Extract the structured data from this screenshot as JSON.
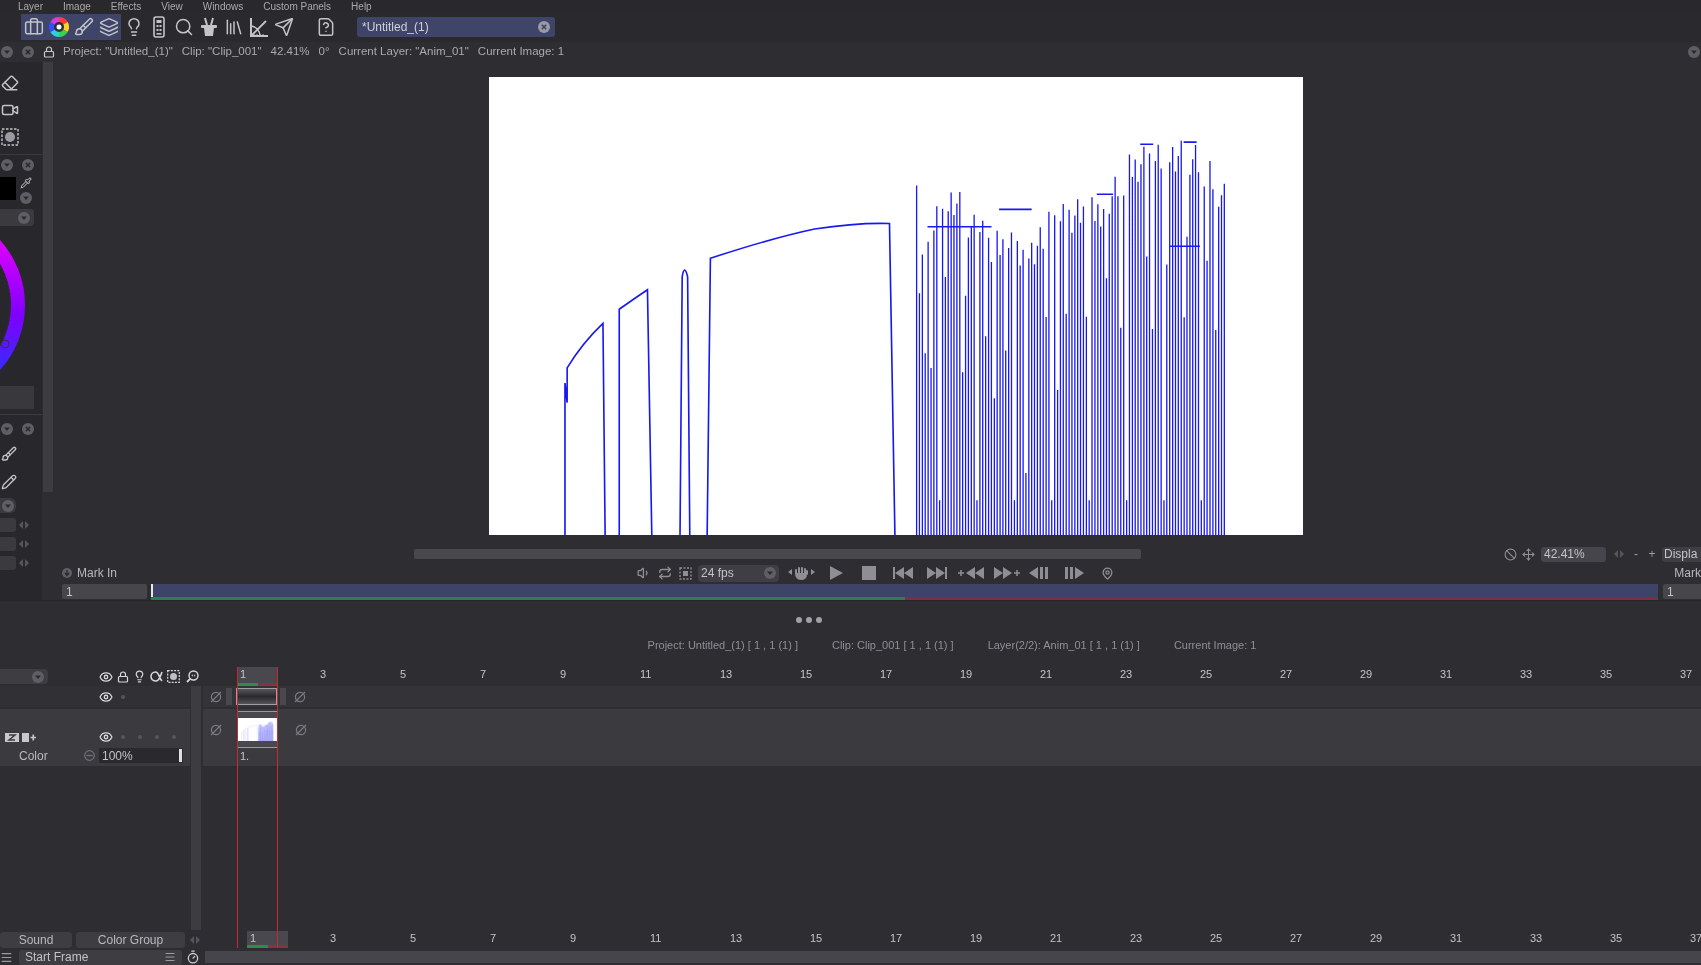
{
  "menu": [
    "Layer",
    "Image",
    "Effects",
    "View",
    "Windows",
    "Custom Panels",
    "Help"
  ],
  "toolbar": {
    "buttons": [
      {
        "selected": true
      },
      {
        "selected": true
      },
      {
        "selected": true
      },
      {
        "selected": true
      },
      {
        "selected": false
      },
      {
        "selected": false
      },
      {
        "selected": false
      },
      {
        "selected": false
      },
      {
        "selected": false
      },
      {
        "selected": false
      },
      {
        "selected": false
      },
      {
        "selected": false
      }
    ]
  },
  "document_tab": {
    "label": "*Untitled_(1)",
    "selected": true
  },
  "info_bar": [
    "Project: \"Untitled_(1)\"",
    "Clip: \"Clip_001\"",
    "42.41%",
    "0°",
    "Current Layer: \"Anim_01\"",
    "Current Image: 1"
  ],
  "viewer": {
    "zoom_field": "42.41%",
    "zoom_out": "-",
    "zoom_in": "+",
    "display_button": "Displa"
  },
  "playback": {
    "mark_in": "Mark In",
    "fps": "24 fps",
    "mark_out": "Mark",
    "start_field": "1",
    "end_field": "1",
    "range": {
      "level": 0.5
    }
  },
  "status": [
    "Project: Untitled_(1) [ 1 , 1 (1) ]",
    "Clip: Clip_001 [ 1 , 1 (1) ]",
    "Layer(2/2): Anim_01 [ 1 , 1 (1) ]",
    "Current Image: 1"
  ],
  "timeline": {
    "frames": [
      {
        "label": "1",
        "selected": true
      },
      {
        "label": "3",
        "selected": false
      },
      {
        "label": "5",
        "selected": false
      },
      {
        "label": "7",
        "selected": false
      },
      {
        "label": "9",
        "selected": false
      },
      {
        "label": "11",
        "selected": false
      },
      {
        "label": "13",
        "selected": false
      },
      {
        "label": "15",
        "selected": false
      },
      {
        "label": "17",
        "selected": false
      },
      {
        "label": "19",
        "selected": false
      },
      {
        "label": "21",
        "selected": false
      },
      {
        "label": "23",
        "selected": false
      },
      {
        "label": "25",
        "selected": false
      },
      {
        "label": "27",
        "selected": false
      },
      {
        "label": "29",
        "selected": false
      },
      {
        "label": "31",
        "selected": false
      },
      {
        "label": "33",
        "selected": false
      },
      {
        "label": "35",
        "selected": false
      },
      {
        "label": "37",
        "selected": false
      }
    ],
    "layers": [
      {
        "kind": "strip",
        "visible": true
      },
      {
        "kind": "layer",
        "visible": true,
        "blend": "Color",
        "opacity": {
          "value": "100%",
          "level": 1
        },
        "frame_label": "1."
      }
    ],
    "bottom_buttons": [
      "Sound",
      "Color Group"
    ],
    "start_frame": "Start Frame",
    "bottom_frames": [
      {
        "label": "1",
        "selected": true
      },
      {
        "label": "3",
        "selected": false
      },
      {
        "label": "5",
        "selected": false
      },
      {
        "label": "7",
        "selected": false
      },
      {
        "label": "9",
        "selected": false
      },
      {
        "label": "11",
        "selected": false
      },
      {
        "label": "13",
        "selected": false
      },
      {
        "label": "15",
        "selected": false
      },
      {
        "label": "17",
        "selected": false
      },
      {
        "label": "19",
        "selected": false
      },
      {
        "label": "21",
        "selected": false
      },
      {
        "label": "23",
        "selected": false
      },
      {
        "label": "25",
        "selected": false
      },
      {
        "label": "27",
        "selected": false
      },
      {
        "label": "29",
        "selected": false
      },
      {
        "label": "31",
        "selected": false
      },
      {
        "label": "33",
        "selected": false
      },
      {
        "label": "35",
        "selected": false
      },
      {
        "label": "37",
        "selected": false
      }
    ]
  }
}
